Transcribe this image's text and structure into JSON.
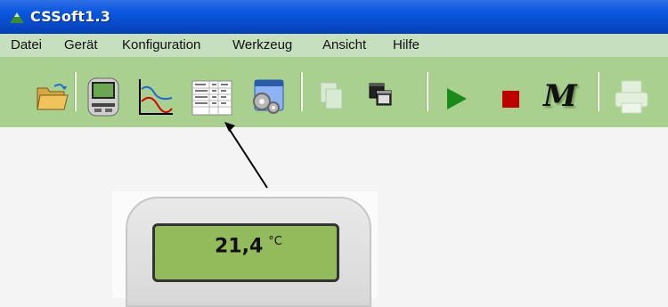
{
  "window": {
    "title": "CSSoft1.3"
  },
  "menu": [
    "Datei",
    "Gerät",
    "Konfiguration",
    "Werkzeug",
    "Ansicht",
    "Hilfe"
  ],
  "toolbar": {
    "buttons": [
      {
        "icon": "open-folder-icon"
      },
      {
        "icon": "device-icon"
      },
      {
        "icon": "line-chart-icon"
      },
      {
        "icon": "data-table-icon"
      },
      {
        "icon": "settings-gears-icon"
      },
      {
        "icon": "copy-icon",
        "disabled": true
      },
      {
        "icon": "windows-icon"
      },
      {
        "icon": "play-icon"
      },
      {
        "icon": "stop-icon"
      },
      {
        "icon": "m-icon"
      },
      {
        "icon": "printer-icon",
        "disabled": true
      }
    ],
    "m_label": "M"
  },
  "device": {
    "value": "21,4",
    "unit": "°C"
  },
  "colors": {
    "titlebar": "#0a57e0",
    "menubar": "#c6e0bf",
    "toolbar": "#a9d08e",
    "play": "#1b8a1b",
    "stop": "#c00000"
  }
}
